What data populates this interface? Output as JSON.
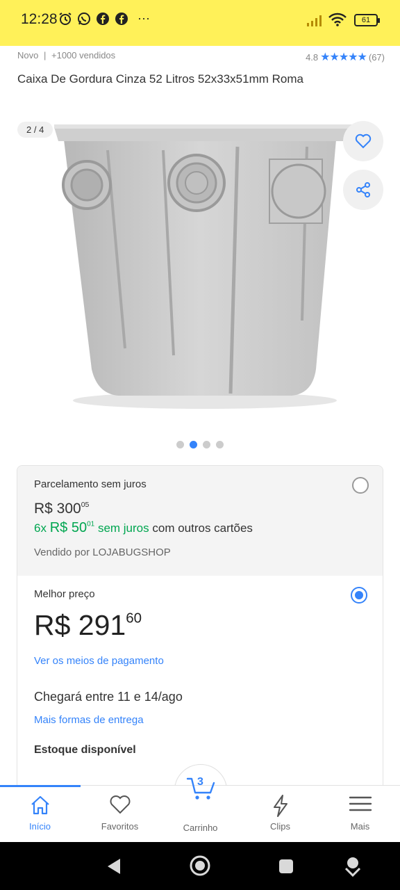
{
  "status_bar": {
    "time": "12:28",
    "battery": "61",
    "more": "···"
  },
  "product": {
    "condition": "Novo",
    "separator": "|",
    "sold": "+1000 vendidos",
    "rating": "4.8",
    "stars": "★★★★★",
    "reviews": "(67)",
    "title": "Caixa De Gordura Cinza 52 Litros 52x33x51mm Roma"
  },
  "gallery": {
    "counter": "2 / 4",
    "total_images": 4,
    "active_dot": 2
  },
  "offer_installments": {
    "heading": "Parcelamento sem juros",
    "price_main": "R$ 300",
    "price_cents": "05",
    "installments_count": "6x",
    "installment_main": "R$ 50",
    "installment_cents": "01",
    "sem_juros": "sem juros",
    "other_cards": "com outros cartões",
    "seller": "Vendido por LOJABUGSHOP",
    "selected": false
  },
  "offer_best": {
    "heading": "Melhor preço",
    "price_main": "R$ 291",
    "price_cents": "60",
    "payment_link": "Ver os meios de pagamento",
    "delivery": "Chegará entre 11 e 14/ago",
    "delivery_link": "Mais formas de entrega",
    "stock": "Estoque disponível",
    "selected": true
  },
  "bottom_nav": {
    "items": [
      {
        "label": "Início",
        "icon": "home-icon",
        "active": true
      },
      {
        "label": "Favoritos",
        "icon": "heart-icon",
        "active": false
      },
      {
        "label": "Carrinho",
        "icon": "cart-icon",
        "active": false,
        "badge": "3"
      },
      {
        "label": "Clips",
        "icon": "bolt-icon",
        "active": false
      },
      {
        "label": "Mais",
        "icon": "menu-icon",
        "active": false
      }
    ]
  },
  "colors": {
    "brand_yellow": "#fff159",
    "accent_blue": "#3483fa",
    "green": "#00a650"
  }
}
